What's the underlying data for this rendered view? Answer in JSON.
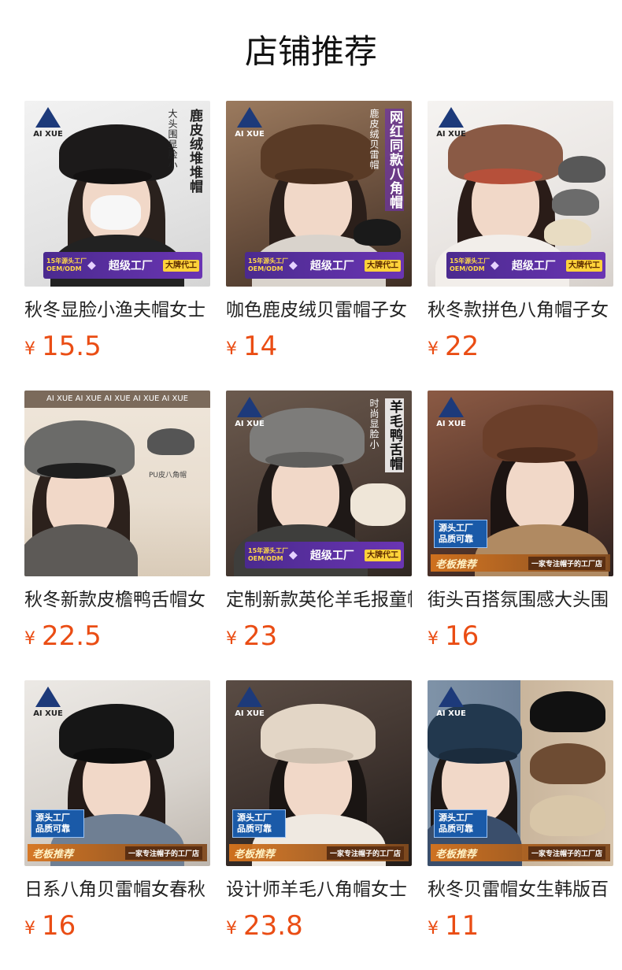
{
  "header": {
    "title": "店铺推荐"
  },
  "products": [
    {
      "title": "秋冬显脸小渔夫帽女士",
      "currency": "¥",
      "price": "15.5",
      "image": {
        "logo": "AI XUE",
        "tag_main": "鹿皮绒堆堆帽",
        "tag_sub": "大头围显脸小",
        "banner_left": "15年源头工厂 OEM/ODM",
        "banner_mid": "超级工厂",
        "banner_right": "大牌代工",
        "hat_color": "#1c1a1a",
        "style": "mask"
      }
    },
    {
      "title": "咖色鹿皮绒贝雷帽子女",
      "currency": "¥",
      "price": "14",
      "image": {
        "logo": "AI XUE",
        "tag_main": "网红同款八角帽",
        "tag_sub": "鹿皮绒贝雷帽",
        "banner_left": "15年源头工厂 OEM/ODM",
        "banner_mid": "超级工厂",
        "banner_right": "大牌代工",
        "hat_color": "#5a3b26",
        "style": "banner"
      }
    },
    {
      "title": "秋冬款拼色八角帽子女",
      "currency": "¥",
      "price": "22",
      "image": {
        "logo": "AI XUE",
        "banner_left": "15年源头工厂 OEM/ODM",
        "banner_mid": "超级工厂",
        "banner_right": "大牌代工",
        "hat_color": "#8a5a45",
        "style": "banner"
      }
    },
    {
      "title": "秋冬新款皮檐鸭舌帽女",
      "currency": "¥",
      "price": "22.5",
      "image": {
        "logo_strip": "AI XUE  AI XUE  AI XUE  AI XUE  AI XUE",
        "tag_sub": "PU皮八角帽",
        "hat_color": "#6b6b69",
        "style": "plain"
      }
    },
    {
      "title": "定制新款英伦羊毛报童帽",
      "currency": "¥",
      "price": "23",
      "image": {
        "logo": "AI XUE",
        "tag_main": "羊毛鸭舌帽",
        "tag_sub": "时尚显脸小",
        "banner_left": "15年源头工厂 OEM/ODM",
        "banner_mid": "超级工厂",
        "banner_right": "大牌代工",
        "hat_color": "#7d7c7a",
        "style": "banner"
      }
    },
    {
      "title": "街头百搭氛围感大头围",
      "currency": "¥",
      "price": "16",
      "image": {
        "logo": "AI XUE",
        "badge": "源头工厂 品质可靠",
        "ribbon_left": "老板推荐",
        "ribbon_right": "一家专注帽子的工厂店",
        "hat_color": "#6b3f2a",
        "style": "ribbon"
      }
    },
    {
      "title": "日系八角贝雷帽女春秋",
      "currency": "¥",
      "price": "16",
      "image": {
        "logo": "AI XUE",
        "badge": "源头工厂 品质可靠",
        "ribbon_left": "老板推荐",
        "ribbon_right": "一家专注帽子的工厂店",
        "hat_color": "#161616",
        "style": "ribbon"
      }
    },
    {
      "title": "设计师羊毛八角帽女士",
      "currency": "¥",
      "price": "23.8",
      "image": {
        "logo": "AI XUE",
        "badge": "源头工厂 品质可靠",
        "ribbon_left": "老板推荐",
        "ribbon_right": "一家专注帽子的工厂店",
        "hat_color": "#e3d6c6",
        "style": "ribbon"
      }
    },
    {
      "title": "秋冬贝雷帽女生韩版百",
      "currency": "¥",
      "price": "11",
      "image": {
        "logo": "AI XUE",
        "badge": "源头工厂 品质可靠",
        "ribbon_left": "老板推荐",
        "ribbon_right": "一家专注帽子的工厂店",
        "hat_color": "#22384e",
        "style": "ribbon"
      }
    }
  ]
}
